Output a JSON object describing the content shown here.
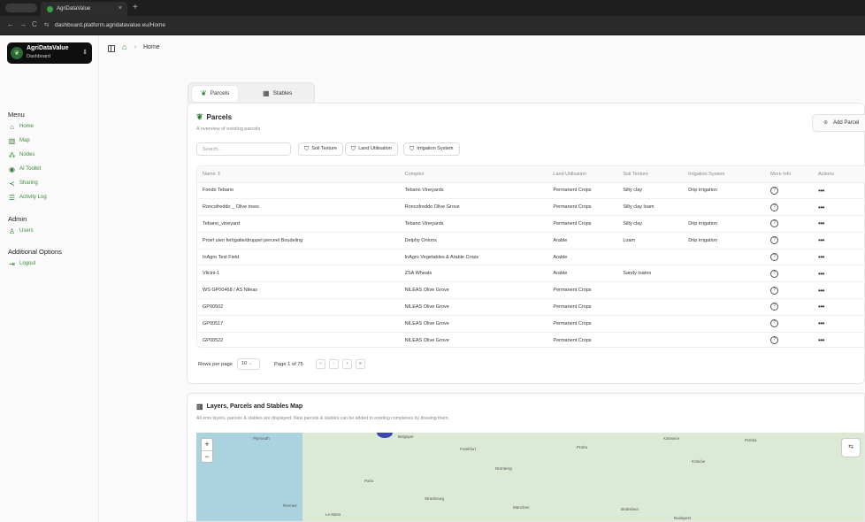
{
  "browser": {
    "tab_title": "AgriDataValue",
    "tab_close": "×",
    "new_tab": "+",
    "url": "dashboard.platform.agridatavalue.eu/Home",
    "nav": [
      "←",
      "→",
      "C"
    ]
  },
  "sidebar": {
    "workspace": {
      "name": "AgriDataValue",
      "subtitle": "Dashboard"
    },
    "menu_title": "Menu",
    "menu": [
      {
        "label": "Home",
        "icon": "home-icon"
      },
      {
        "label": "Map",
        "icon": "map-icon"
      },
      {
        "label": "Nodes",
        "icon": "nodes-icon"
      },
      {
        "label": "AI Toolkit",
        "icon": "ai-icon"
      },
      {
        "label": "Sharing",
        "icon": "share-icon"
      },
      {
        "label": "Activity Log",
        "icon": "list-icon"
      }
    ],
    "admin_title": "Admin",
    "admin": [
      {
        "label": "Users",
        "icon": "user-icon"
      }
    ],
    "additional_title": "Additional Options",
    "additional": [
      {
        "label": "Logout",
        "icon": "logout-icon"
      }
    ]
  },
  "breadcrumb": {
    "current": "Home",
    "separator": "›"
  },
  "tabs": [
    {
      "label": "Parcels",
      "active": true
    },
    {
      "label": "Stables",
      "active": false
    }
  ],
  "parcels": {
    "title": "Parcels",
    "subtitle": "A overview of existing parcels",
    "add_button": "Add Parcel",
    "search_placeholder": "Search...",
    "filters": [
      "Soil Texture",
      "Land Utilisation",
      "Irrigation System"
    ],
    "columns": [
      "Name ⇕",
      "Complex",
      "Land Utilisation",
      "Soil Texture",
      "Irrigation System",
      "More Info",
      "Actions"
    ],
    "rows": [
      [
        "Fondo Tebano",
        "Tebano Vineyards",
        "Permanent Crops",
        "Silty clay",
        "Drip irrigation"
      ],
      [
        "Roncofreddo _ Olive trees",
        "Roncofreddo Olive Grove",
        "Permanent Crops",
        "Silty clay loam",
        ""
      ],
      [
        "Tebano_vineyard",
        "Tebano Vineyards",
        "Permanent Crops",
        "Silty clay",
        "Drip irrigation"
      ],
      [
        "Proef uien fertigatie/druppel perceel Boudeling",
        "Delphy Onions",
        "Arable",
        "Loam",
        "Drip irrigation"
      ],
      [
        "InAgro Test Field",
        "InAgro Vegetables & Arable Crops",
        "Arable",
        "",
        ""
      ],
      [
        "Vilcini-1",
        "ZSA Wheats",
        "Arable",
        "Sandy loams",
        ""
      ],
      [
        "WS GP00468 / AS Nileas",
        "NILEAS Olive Grove",
        "Permanent Crops",
        "",
        ""
      ],
      [
        "GP00502",
        "NILEAS Olive Grove",
        "Permanent Crops",
        "",
        ""
      ],
      [
        "GP00517",
        "NILEAS Olive Grove",
        "Permanent Crops",
        "",
        ""
      ],
      [
        "GP00522",
        "NILEAS Olive Grove",
        "Permanent Crops",
        "",
        ""
      ]
    ],
    "more_info_glyph": "?",
    "actions_glyph": "•••",
    "pagination": {
      "rows_label": "Rows per page",
      "rows_value": "10",
      "page_text": "Page 1 of 75",
      "buttons": [
        "«",
        "‹",
        "›",
        "»"
      ]
    }
  },
  "map_section": {
    "title": "Layers, Parcels and Stables Map",
    "subtitle": "All ems layers, parcels & stables are displayed. New parcels & stables can be added to existing complexes by drawing them.",
    "zoom_in": "+",
    "zoom_out": "−",
    "layer_glyph": "⇆",
    "labels": [
      "Belgique",
      "Praha",
      "Katowice",
      "Plymouth",
      "Frankfurt",
      "Nürnberg",
      "Paris",
      "Rennes",
      "Le Mans",
      "Strasbourg",
      "München",
      "Bratislava",
      "Budapest",
      "Polska",
      "Kraków"
    ]
  },
  "colors": {
    "accent": "#2f7e2f",
    "sidebar_workspace_bg": "#0f0f0f",
    "map_sea": "#aad3df",
    "map_land": "#dce9d4"
  }
}
